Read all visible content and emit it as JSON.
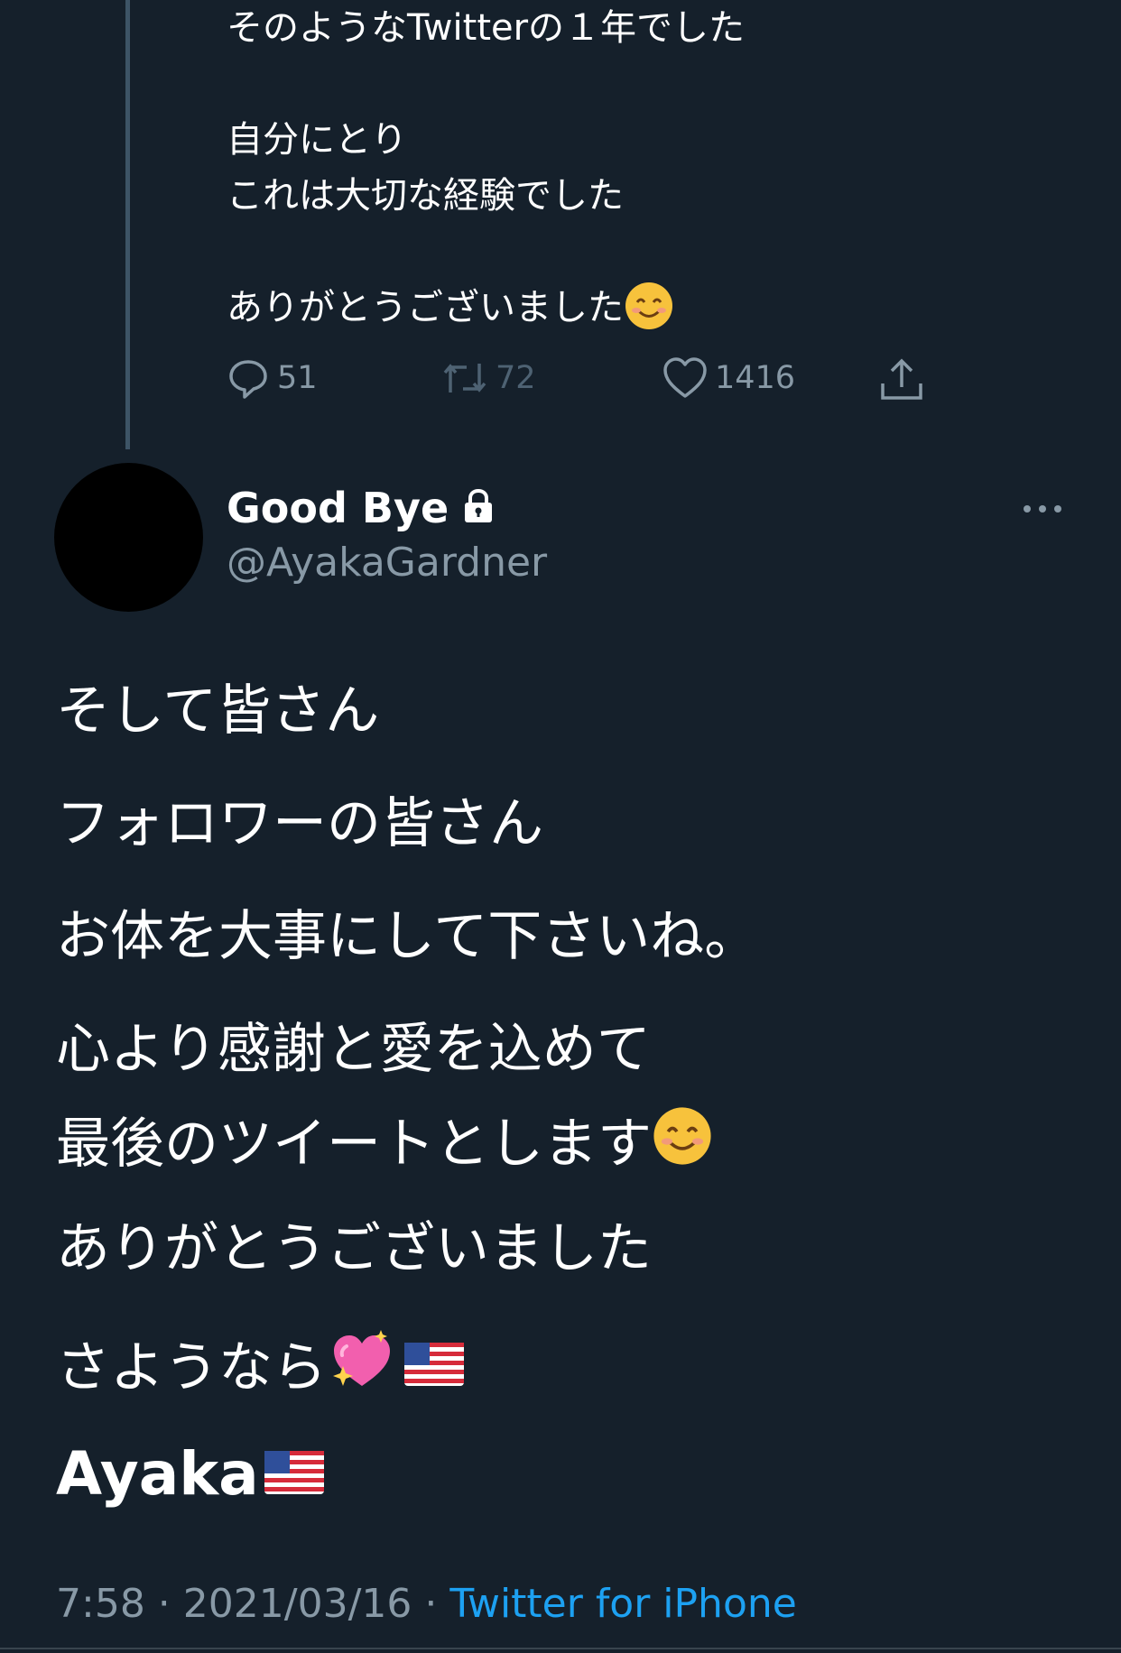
{
  "previous_tweet": {
    "lines": [
      "そのようなTwitterの１年でした",
      "",
      "自分にとり",
      "これは大切な経験でした",
      "",
      "ありがとうございました"
    ],
    "reply_count": "51",
    "retweet_count": "72",
    "like_count": "1416"
  },
  "tweet": {
    "display_name": "Good Bye",
    "handle": "@AyakaGardner",
    "lines": [
      "そして皆さん",
      "フォロワーの皆さん",
      "お体を大事にして下さいね。",
      "心より感謝と愛を込めて",
      "最後のツイートとします",
      "ありがとうございました",
      "さようなら"
    ],
    "signature": "Ayaka",
    "time": "7:58",
    "date": "2021/03/16",
    "separator": " · ",
    "source": "Twitter for iPhone"
  },
  "colors": {
    "background": "#15202b",
    "secondary_text": "#8899a6",
    "link": "#1da1f2"
  },
  "icons": [
    "reply-icon",
    "retweet-icon",
    "like-icon",
    "share-icon",
    "lock-icon",
    "more-icon",
    "smile-emoji",
    "sparkling-heart-emoji",
    "us-flag-emoji"
  ]
}
